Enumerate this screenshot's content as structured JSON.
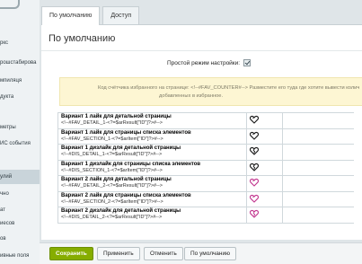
{
  "sidebar": {
    "items": [
      {
        "label": "ркс"
      },
      {
        "label": "рошстабирова"
      },
      {
        "label": "мпиляця"
      },
      {
        "label": "дукта"
      },
      {
        "label": "метры"
      },
      {
        "label": "ИС события"
      },
      {
        "label": "улий"
      },
      {
        "label": "чно"
      },
      {
        "label": "ат"
      },
      {
        "label": "иесов"
      },
      {
        "label": "ов"
      },
      {
        "label": "ивные поля"
      }
    ]
  },
  "tabs": [
    {
      "label": "По умолчанию"
    },
    {
      "label": "Доступ"
    }
  ],
  "page_title": "По умолчанию",
  "simple_mode": {
    "label": "Простой режим настройки:",
    "checked": true
  },
  "notice": {
    "line1": "Код счётчика избранного на странице: <!--#FAV_COUNTER#--> Разместите его туда где хотите вывести колич",
    "line2": "добавленных в избранное."
  },
  "settings_rows": [
    {
      "title": "Вариант 1 лайк для детальной страницы",
      "code": "<!--#FAV_DETAIL_1-<?=$arResult[\"ID\"]?>#-->",
      "icon": "heart-outline-dark-icon",
      "color": "#1a1a1a"
    },
    {
      "title": "Вариант 1 лайк для страницы списка элементов",
      "code": "<!--#FAV_SECTION_1-<?=$arItem[\"ID\"]?>#-->",
      "icon": "heart-outline-dark-icon",
      "color": "#1a1a1a"
    },
    {
      "title": "Вариант 1 дизлайк для детальной страницы",
      "code": "<!--#DIS_DETAIL_1-<?=$arResult[\"ID\"]?>#-->",
      "icon": "heart-broken-dark-icon",
      "color": "#1a1a1a"
    },
    {
      "title": "Вариант 1 дизлайк для страницы списка элементов",
      "code": "<!--#DIS_SECTION_1-<?=$arItem[\"ID\"]?>#-->",
      "icon": "heart-broken-dark-icon",
      "color": "#1a1a1a"
    },
    {
      "title": "Вариант 2 лайк для детальной страницы",
      "code": "<!--#FAV_DETAIL_2-<?=$arResult[\"ID\"]?>#-->",
      "icon": "heart-outline-pink-icon",
      "color": "#c2368f"
    },
    {
      "title": "Вариант 2 лайк для страницы списка элементов",
      "code": "<!--#FAV_SECTION_2-<?=$arItem[\"ID\"]?>#-->",
      "icon": "heart-outline-pink-icon",
      "color": "#c2368f"
    },
    {
      "title": "Вариант 2 дизлайк для детальной страницы",
      "code": "<!--#DIS_DETAIL_2-<?=$arResult[\"ID\"]?>#-->",
      "icon": "heart-broken-pink-icon",
      "color": "#c2368f"
    }
  ],
  "buttons": {
    "save": "Сохранить",
    "apply": "Применить",
    "cancel": "Отменить",
    "default": "По умолчанию"
  }
}
